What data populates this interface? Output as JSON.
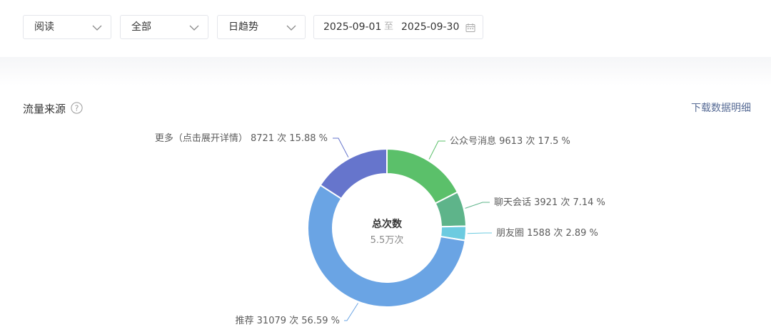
{
  "filters": {
    "metric": "阅读",
    "scope": "全部",
    "granularity": "日趋势",
    "date_start": "2025-09-01",
    "date_separator": "至",
    "date_end": "2025-09-30"
  },
  "section": {
    "title": "流量来源",
    "help_glyph": "?",
    "download_label": "下载数据明细"
  },
  "chart_data": {
    "type": "pie",
    "variant": "donut",
    "center_title": "总次数",
    "center_value": "5.5万次",
    "slices": [
      {
        "name": "公众号消息",
        "value": 9613,
        "percent": 17.5,
        "color": "#5bc06a",
        "label": "公众号消息 9613 次 17.5 %"
      },
      {
        "name": "聊天会话",
        "value": 3921,
        "percent": 7.14,
        "color": "#5eb48a",
        "label": "聊天会话 3921 次 7.14 %"
      },
      {
        "name": "朋友圈",
        "value": 1588,
        "percent": 2.89,
        "color": "#6ccbe0",
        "label": "朋友圈 1588 次 2.89 %"
      },
      {
        "name": "推荐",
        "value": 31079,
        "percent": 56.59,
        "color": "#6aa4e4",
        "label": "推荐 31079 次 56.59 %"
      },
      {
        "name": "更多（点击展开详情）",
        "value": 8721,
        "percent": 15.88,
        "color": "#6675cc",
        "label": "更多（点击展开详情） 8721 次 15.88 %"
      }
    ]
  }
}
